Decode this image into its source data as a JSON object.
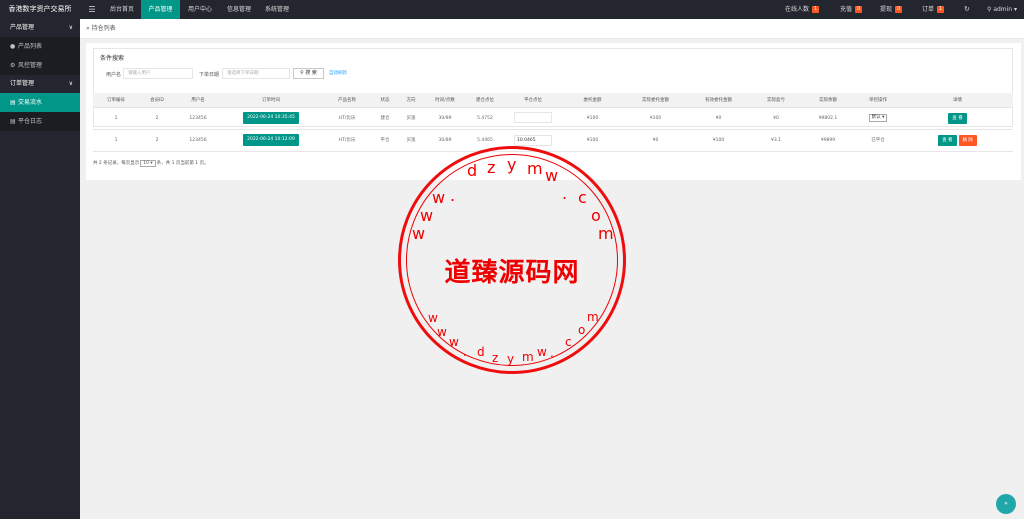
{
  "app": {
    "title": "香港数字资产交易所"
  },
  "topnav": [
    {
      "label": "后台首页"
    },
    {
      "label": "产品管理"
    },
    {
      "label": "用户中心"
    },
    {
      "label": "信息管理"
    },
    {
      "label": "系统管理"
    }
  ],
  "topright": {
    "online": {
      "label": "在线人数",
      "count": "1"
    },
    "recharge": {
      "label": "充值",
      "count": "0"
    },
    "withdraw": {
      "label": "提现",
      "count": "0"
    },
    "orders": {
      "label": "订单",
      "count": "1"
    },
    "refresh_icon": "↻",
    "user": "admin"
  },
  "sidebar": {
    "groups": [
      {
        "label": "产品管理",
        "items": [
          {
            "label": "产品列表",
            "icon": "●"
          },
          {
            "label": "风控管理",
            "icon": "⚙"
          }
        ]
      },
      {
        "label": "订单管理",
        "items": [
          {
            "label": "交易流水",
            "icon": "▤"
          },
          {
            "label": "平仓日志",
            "icon": "▤"
          }
        ]
      }
    ]
  },
  "breadcrumb": {
    "text": "持仓列表"
  },
  "search": {
    "legend": "条件搜索",
    "user_label": "用户名",
    "user_placeholder": "请输入用户",
    "date_label": "下单日期",
    "date_placeholder": "请选择下单日期",
    "search_button": "搜 索",
    "refresh_link": "自动刷新"
  },
  "table": {
    "columns": [
      "订单编号",
      "会员ID",
      "用户名",
      "订单时间",
      "产品名称",
      "状态",
      "方向",
      "时间/点数",
      "建仓点位",
      "平仓点位",
      "委托金额",
      "实际委托金额",
      "有效委托金额",
      "实际盈亏",
      "实际余额",
      "单控操作",
      "详情"
    ],
    "rows": [
      {
        "id": "1",
        "member": "2",
        "user": "123456",
        "time": "2022-06-24 10:35:45",
        "product": "HT/比乐",
        "status": "建仓",
        "direction": "买涨",
        "seconds": "30/89",
        "open": "5.4752",
        "close": "",
        "amount": "¥100",
        "real_amount": "¥100",
        "valid_amount": "¥0",
        "profit": "¥0",
        "balance": "¥9802.1",
        "control": "默认 ▾",
        "actions": [
          "查 看"
        ]
      },
      {
        "id": "1",
        "member": "2",
        "user": "123456",
        "time": "2022-06-24 10:12:09",
        "product": "HT/比乐",
        "status": "平仓",
        "direction": "买涨",
        "seconds": "30/89",
        "open": "5.4465",
        "close": "10.0465",
        "amount": "¥100",
        "real_amount": "¥0",
        "valid_amount": "¥100",
        "profit": "¥3.1",
        "balance": "¥9899",
        "control": "已平仓",
        "actions": [
          "查 看",
          "删 除"
        ]
      }
    ]
  },
  "pager": {
    "pre": "共 2 条记录，每页显示",
    "size": "10 ▾",
    "post": "条，共 1 页当前第 1 页。"
  },
  "watermark": {
    "top_letters": [
      "w",
      "w",
      "w",
      ".",
      "d",
      "z",
      "y",
      "m",
      "w",
      ".",
      "c",
      "o",
      "m"
    ],
    "title": "道臻源码网",
    "bottom_letters": [
      "w",
      "w",
      "w",
      ".",
      "d",
      "z",
      "y",
      "m",
      "w",
      ".",
      "c",
      "o",
      "m"
    ]
  },
  "float_icon": "»"
}
